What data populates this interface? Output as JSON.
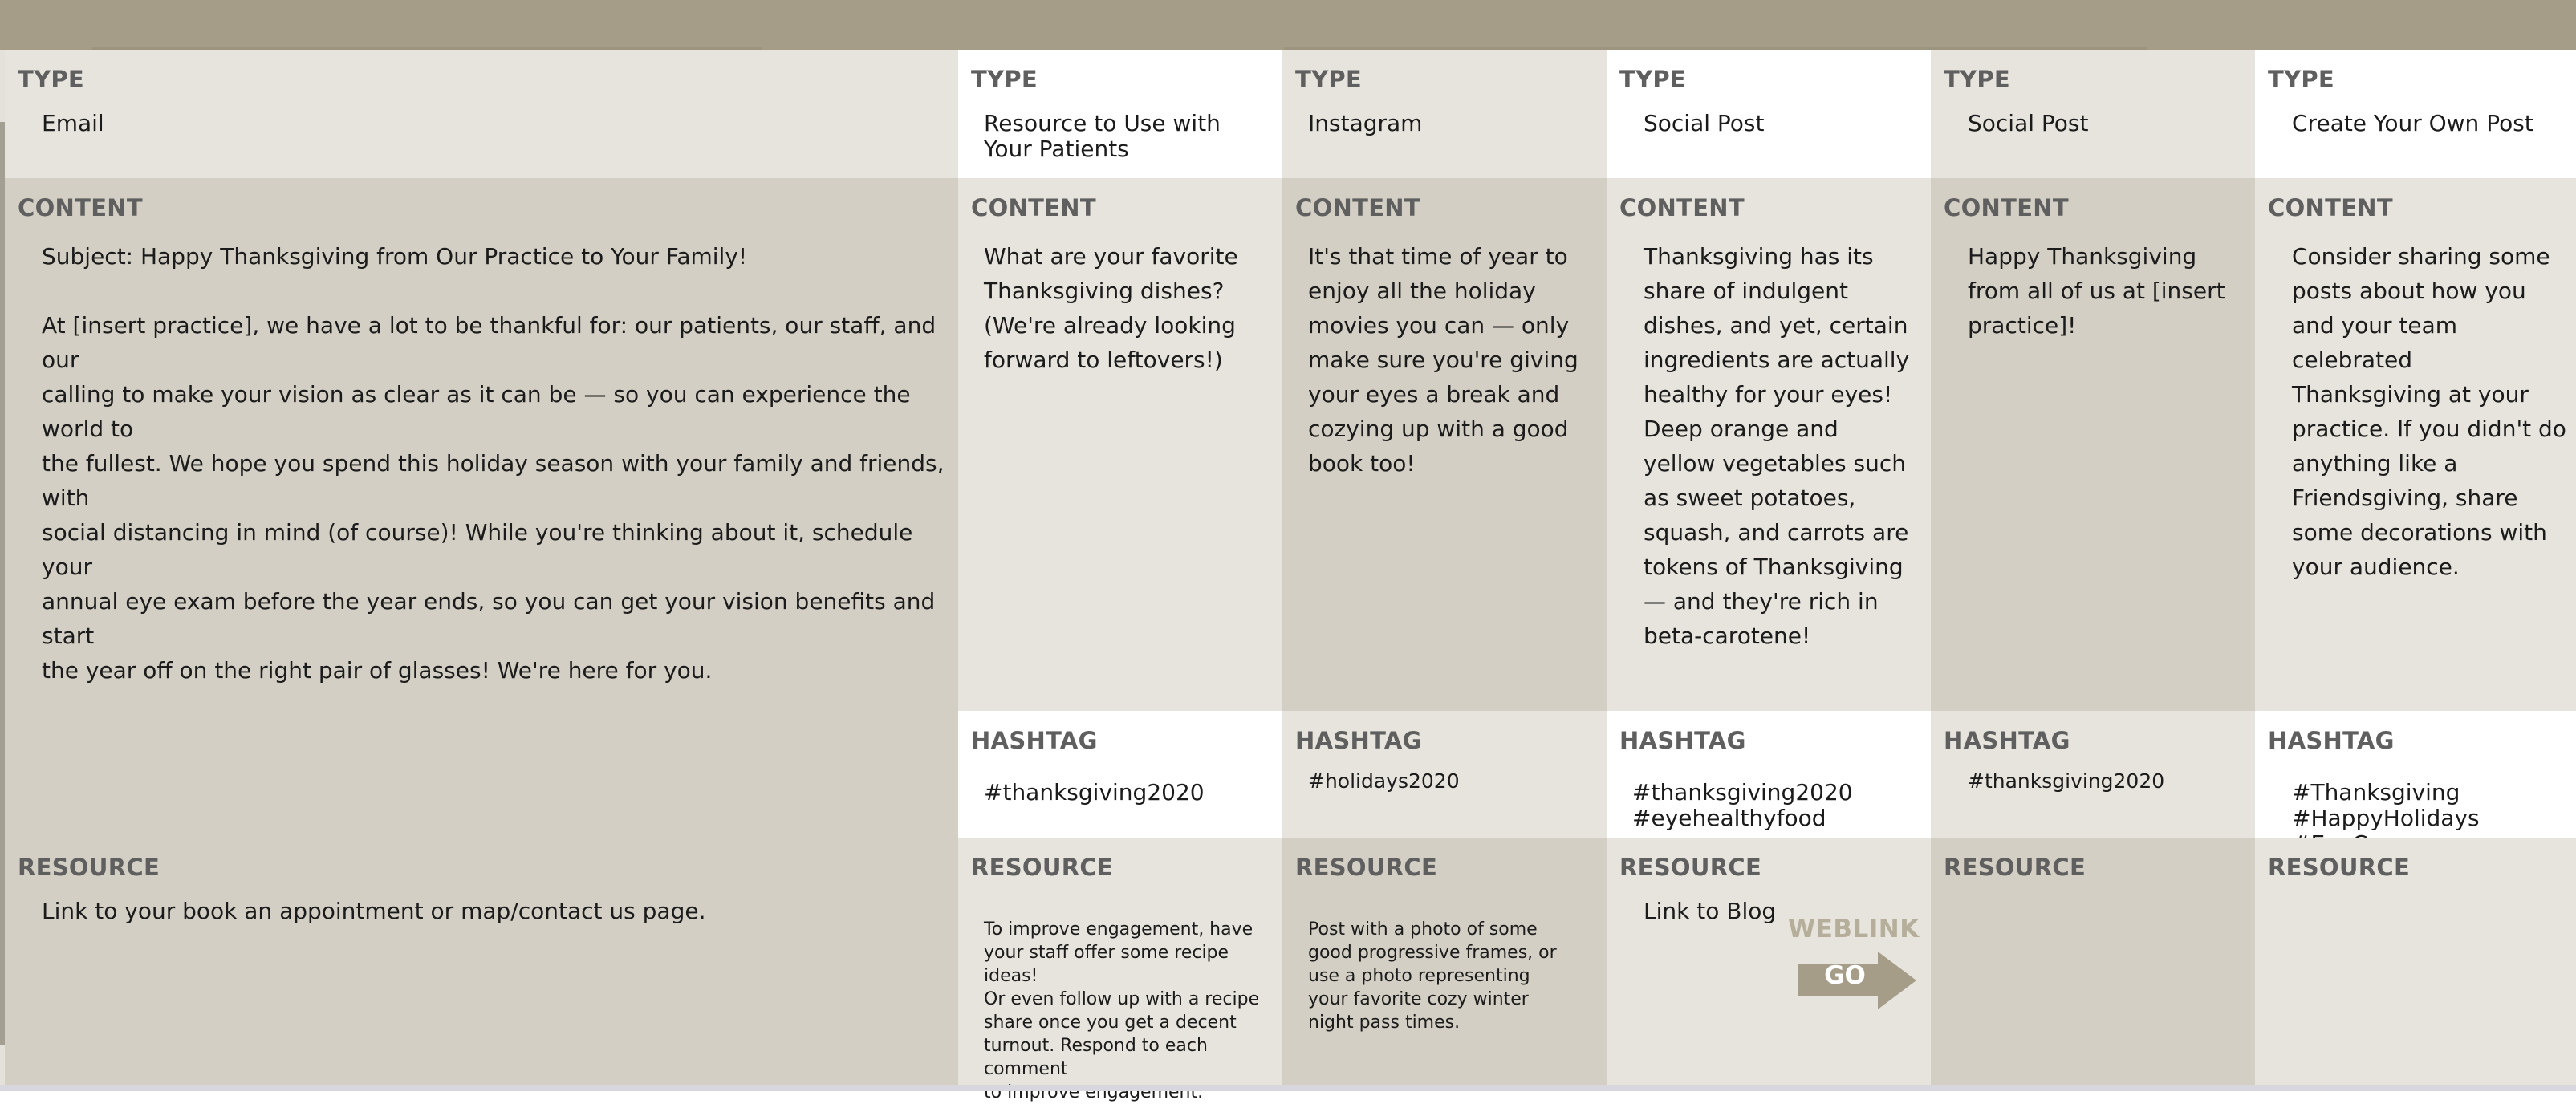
{
  "labels": {
    "type": "TYPE",
    "content": "CONTENT",
    "hashtag": "HASHTAG",
    "resource": "RESOURCE"
  },
  "colors": {
    "header_bar": "#a59d88",
    "light_cell": "#e6e4dc",
    "dark_cell": "#d3cfc4",
    "white_cell": "#ffffff",
    "label_text": "#5f5f5f",
    "weblink_accent": "#a59d88"
  },
  "columns": [
    {
      "type": "Email",
      "content": "Subject: Happy Thanksgiving from Our Practice to Your Family!\n\nAt [insert practice], we have a lot to be thankful for: our patients, our staff, and our\ncalling to make your vision as clear as it can be — so you can experience the world to\nthe fullest. We hope you spend this holiday season with your family and friends, with\nsocial distancing in mind (of course)! While you're thinking about it, schedule your\nannual eye exam before the year ends, so you can get your vision benefits and start\nthe year off on the right pair of glasses! We're here for you.",
      "resource": "Link to your book an appointment or map/contact us page."
    },
    {
      "type": "Resource to Use with\nYour Patients",
      "content": "What are your favorite\nThanksgiving dishes?\n(We're already looking\nforward to leftovers!)",
      "hashtag": "#thanksgiving2020",
      "resource": "To improve engagement, have\nyour staff offer some recipe ideas!\nOr even follow up with a recipe\nshare once you get a decent\nturnout. Respond to each comment\nto improve engagement."
    },
    {
      "type": "Instagram",
      "content": "It's that time of year to\nenjoy all the holiday\nmovies you can — only\nmake sure you're giving\nyour eyes a break and\ncozying up with a good\nbook too!",
      "hashtag": "#holidays2020",
      "resource": "Post with a photo of some\ngood progressive frames, or\nuse a photo representing\nyour favorite cozy winter\nnight pass times."
    },
    {
      "type": "Social Post",
      "content": "Thanksgiving has its\nshare of indulgent\ndishes, and yet, certain\ningredients are actually\nhealthy for your eyes!\nDeep orange and\nyellow vegetables such\nas sweet potatoes,\nsquash, and carrots are\ntokens of Thanksgiving\n— and they're rich in\nbeta-carotene!",
      "hashtag": "#thanksgiving2020\n#eyehealthyfood",
      "resource": "Link to Blog",
      "weblink_word": "WEBLINK",
      "weblink_go": "GO"
    },
    {
      "type": "Social Post",
      "content": "Happy Thanksgiving\nfrom all of us at [insert\npractice]!",
      "hashtag": "#thanksgiving2020",
      "resource": ""
    },
    {
      "type": "Create Your Own Post",
      "content": "Consider sharing some\nposts about how you\nand your team\ncelebrated\nThanksgiving at your\npractice. If you didn't do\nanything like a\nFriendsgiving, share\nsome decorations with\nyour audience.",
      "hashtag": "#Thanksgiving\n#HappyHolidays #EyeCare",
      "resource": ""
    }
  ]
}
